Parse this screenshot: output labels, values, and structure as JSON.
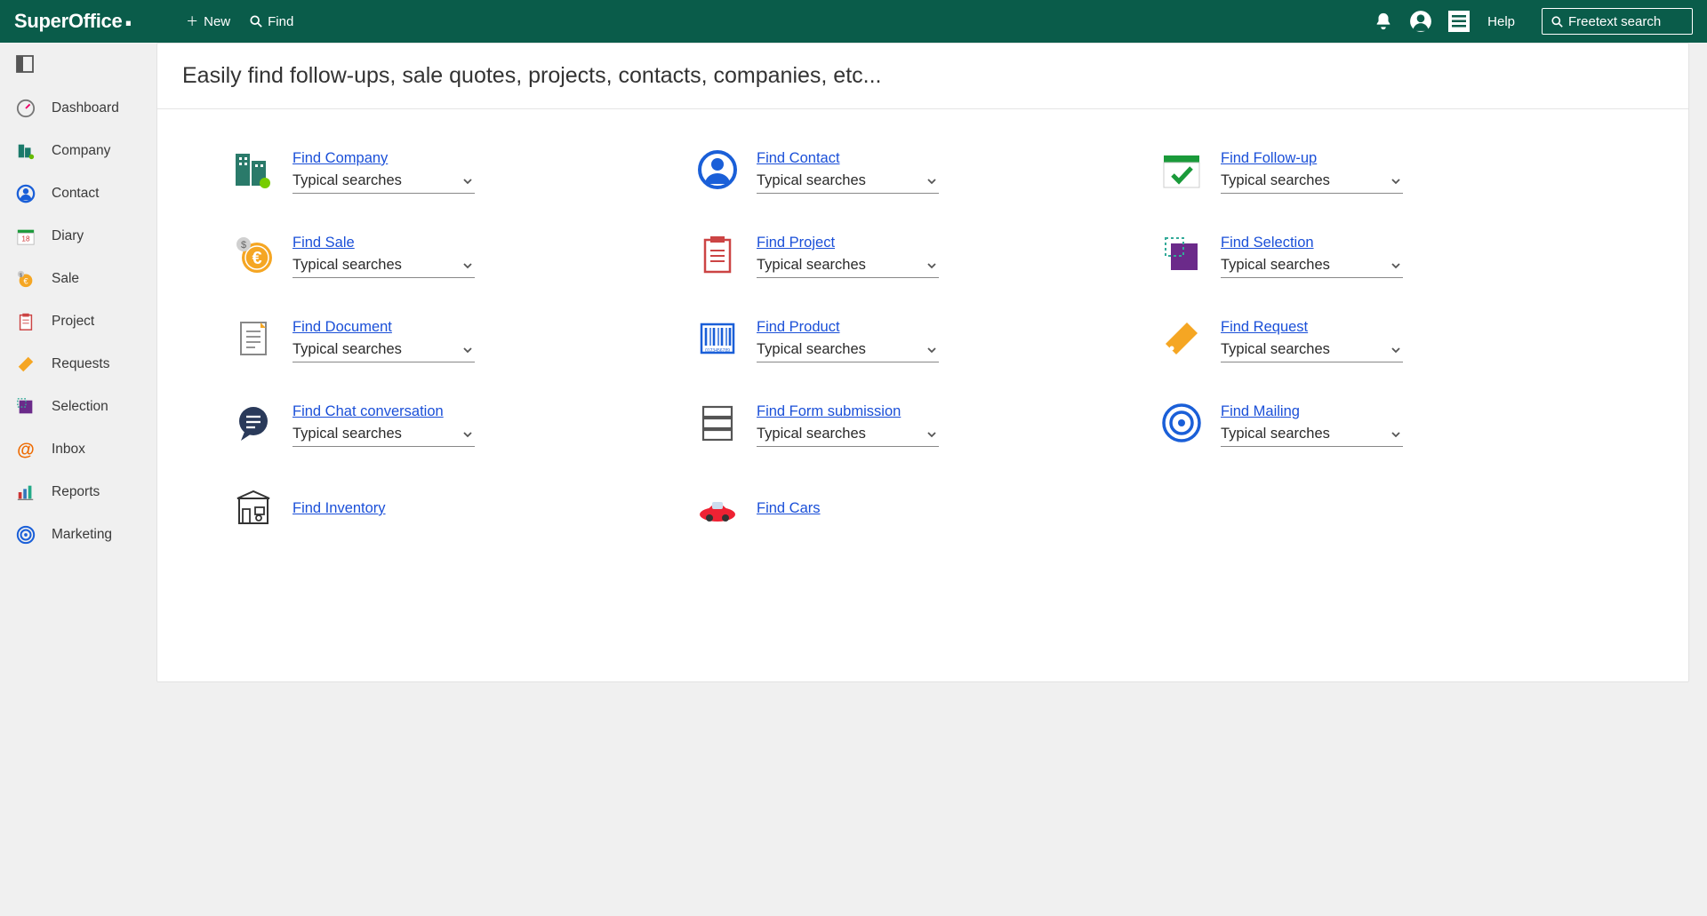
{
  "brand": "SuperOffice",
  "topbar": {
    "new_label": "New",
    "find_label": "Find",
    "help_label": "Help",
    "freetext_placeholder": "Freetext search"
  },
  "sidebar": {
    "items": [
      {
        "label": "Dashboard",
        "icon": "dashboard"
      },
      {
        "label": "Company",
        "icon": "company"
      },
      {
        "label": "Contact",
        "icon": "contact"
      },
      {
        "label": "Diary",
        "icon": "diary"
      },
      {
        "label": "Sale",
        "icon": "sale"
      },
      {
        "label": "Project",
        "icon": "project"
      },
      {
        "label": "Requests",
        "icon": "requests"
      },
      {
        "label": "Selection",
        "icon": "selection"
      },
      {
        "label": "Inbox",
        "icon": "inbox"
      },
      {
        "label": "Reports",
        "icon": "reports"
      },
      {
        "label": "Marketing",
        "icon": "marketing"
      }
    ]
  },
  "panel": {
    "header": "Easily find follow-ups, sale quotes, projects, contacts, companies, etc...",
    "typical_label": "Typical searches",
    "cells": [
      {
        "title": "Find Company",
        "icon": "company",
        "has_dd": true
      },
      {
        "title": "Find Contact",
        "icon": "contact",
        "has_dd": true
      },
      {
        "title": "Find Follow-up",
        "icon": "followup",
        "has_dd": true
      },
      {
        "title": "Find Sale",
        "icon": "sale",
        "has_dd": true
      },
      {
        "title": "Find Project",
        "icon": "project",
        "has_dd": true
      },
      {
        "title": "Find Selection",
        "icon": "selection",
        "has_dd": true
      },
      {
        "title": "Find Document",
        "icon": "document",
        "has_dd": true
      },
      {
        "title": "Find Product",
        "icon": "product",
        "has_dd": true
      },
      {
        "title": "Find Request",
        "icon": "request",
        "has_dd": true
      },
      {
        "title": "Find Chat conversation",
        "icon": "chat",
        "has_dd": true
      },
      {
        "title": "Find Form submission",
        "icon": "form",
        "has_dd": true
      },
      {
        "title": "Find Mailing",
        "icon": "mailing",
        "has_dd": true
      },
      {
        "title": "Find Inventory",
        "icon": "inventory",
        "has_dd": false
      },
      {
        "title": "Find Cars",
        "icon": "car",
        "has_dd": false
      }
    ]
  }
}
